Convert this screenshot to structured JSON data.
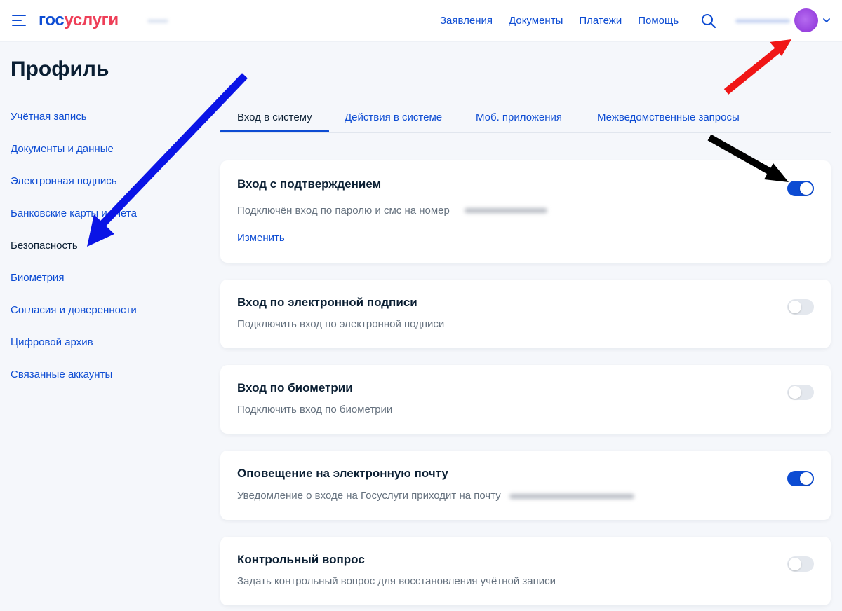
{
  "header": {
    "logo_part1": "гос",
    "logo_part2": "услуги",
    "nav": [
      "Заявления",
      "Документы",
      "Платежи",
      "Помощь"
    ]
  },
  "page_title": "Профиль",
  "sidebar": {
    "items": [
      {
        "label": "Учётная запись"
      },
      {
        "label": "Документы и данные"
      },
      {
        "label": "Электронная подпись"
      },
      {
        "label": "Банковские карты и счета"
      },
      {
        "label": "Безопасность",
        "active": true
      },
      {
        "label": "Биометрия"
      },
      {
        "label": "Согласия и доверенности"
      },
      {
        "label": "Цифровой архив"
      },
      {
        "label": "Связанные аккаунты"
      }
    ]
  },
  "tabs": [
    "Вход в систему",
    "Действия в системе",
    "Моб. приложения",
    "Межведомственные запросы"
  ],
  "cards": [
    {
      "title": "Вход с подтверждением",
      "desc": "Подключён вход по паролю и смс на номер",
      "link": "Изменить",
      "enabled": true
    },
    {
      "title": "Вход по электронной подписи",
      "desc": "Подключить вход по электронной подписи",
      "enabled": false
    },
    {
      "title": "Вход по биометрии",
      "desc": "Подключить вход по биометрии",
      "enabled": false
    },
    {
      "title": "Оповещение на электронную почту",
      "desc": "Уведомление о входе на Госуслуги приходит на почту",
      "enabled": true
    },
    {
      "title": "Контрольный вопрос",
      "desc": "Задать контрольный вопрос для восстановления учётной записи",
      "enabled": false
    }
  ],
  "icons": {
    "menu": "menu-icon",
    "search": "search-icon",
    "avatar": "avatar",
    "caret": "chevron-down-icon"
  },
  "colors": {
    "brand_blue": "#0d4cd3",
    "brand_red": "#ee3f58",
    "text": "#0b1f33",
    "muted": "#66727f",
    "background": "#f5f7fb"
  }
}
